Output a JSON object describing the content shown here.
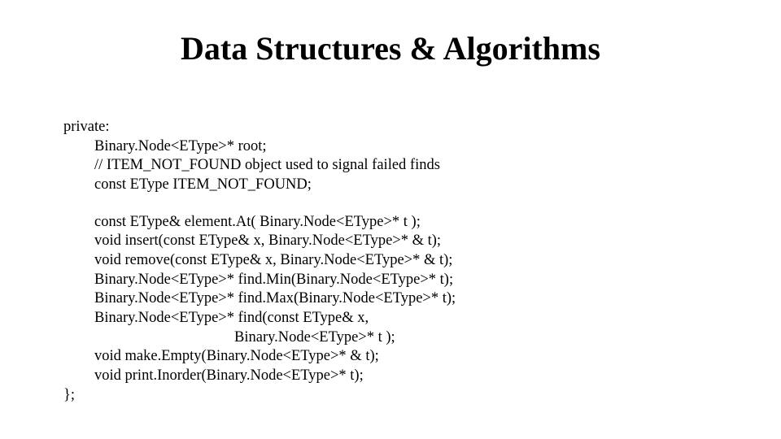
{
  "title": "Data Structures & Algorithms",
  "code": {
    "l0": "private:",
    "l1": "Binary.Node<EType>* root;",
    "l2": "// ITEM_NOT_FOUND object used to signal failed finds",
    "l3": "const EType ITEM_NOT_FOUND;",
    "l4": "const EType& element.At( Binary.Node<EType>* t );",
    "l5": "void insert(const EType& x, Binary.Node<EType>* & t);",
    "l6": "void remove(const EType& x, Binary.Node<EType>* & t);",
    "l7": "Binary.Node<EType>* find.Min(Binary.Node<EType>* t);",
    "l8": "Binary.Node<EType>* find.Max(Binary.Node<EType>* t);",
    "l9": "Binary.Node<EType>* find(const EType& x,",
    "l10": "Binary.Node<EType>* t );",
    "l11": "void make.Empty(Binary.Node<EType>* & t);",
    "l12": "void print.Inorder(Binary.Node<EType>* t);",
    "l13": "};"
  }
}
